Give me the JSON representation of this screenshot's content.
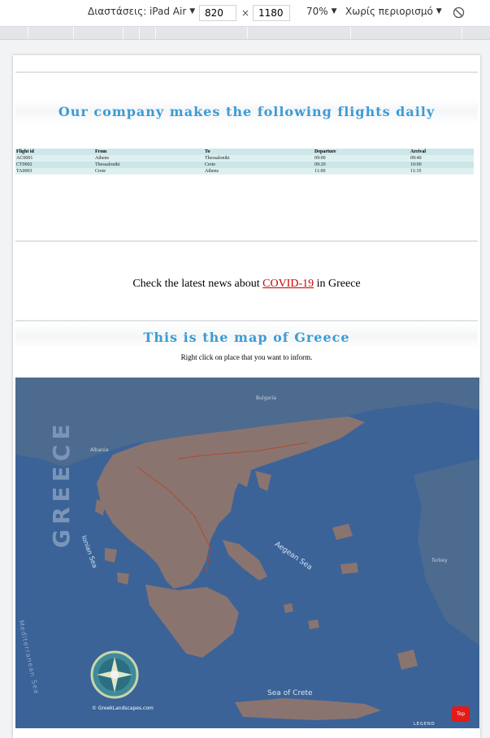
{
  "devtools": {
    "dimensions_label": "Διαστάσεις: iPad Air",
    "width": "820",
    "height": "1180",
    "zoom": "70%",
    "throttle": "Χωρίς περιορισμό"
  },
  "flights": {
    "title": "Our company makes the following flights daily",
    "columns": [
      "Flight id",
      "From",
      "To",
      "Departure",
      "Arrival"
    ],
    "rows": [
      [
        "AC0001",
        "Athens",
        "Thessaloniki",
        "09:00",
        "09:40"
      ],
      [
        "CT0002",
        "Thessaloniki",
        "Crete",
        "09:20",
        "10:00"
      ],
      [
        "TA0003",
        "Crete",
        "Athens",
        "11:00",
        "11:35"
      ]
    ]
  },
  "news": {
    "prefix": "Check the latest news about ",
    "link": "COVID-19",
    "suffix": " in Greece"
  },
  "map_section": {
    "title": "This is the map of Greece",
    "subtitle": "Right click on place that you want to inform."
  },
  "map_labels": {
    "country": "GREECE",
    "ionian": "Ionian Sea",
    "aegean": "Aegean Sea",
    "crete_sea": "Sea of Crete",
    "med": "Mediterranean Sea",
    "bulgaria": "Bulgaria",
    "albania": "Albania",
    "turkey": "Turkey",
    "credit": "© GreekLandscapes.com",
    "legend": "LEGEND"
  },
  "colors": {
    "accent": "#3d9bd4",
    "sea": "#3b6398",
    "land": "#8a7470",
    "link": "#cc0000",
    "top_button": "#e21b1b"
  },
  "top_button": "Top"
}
